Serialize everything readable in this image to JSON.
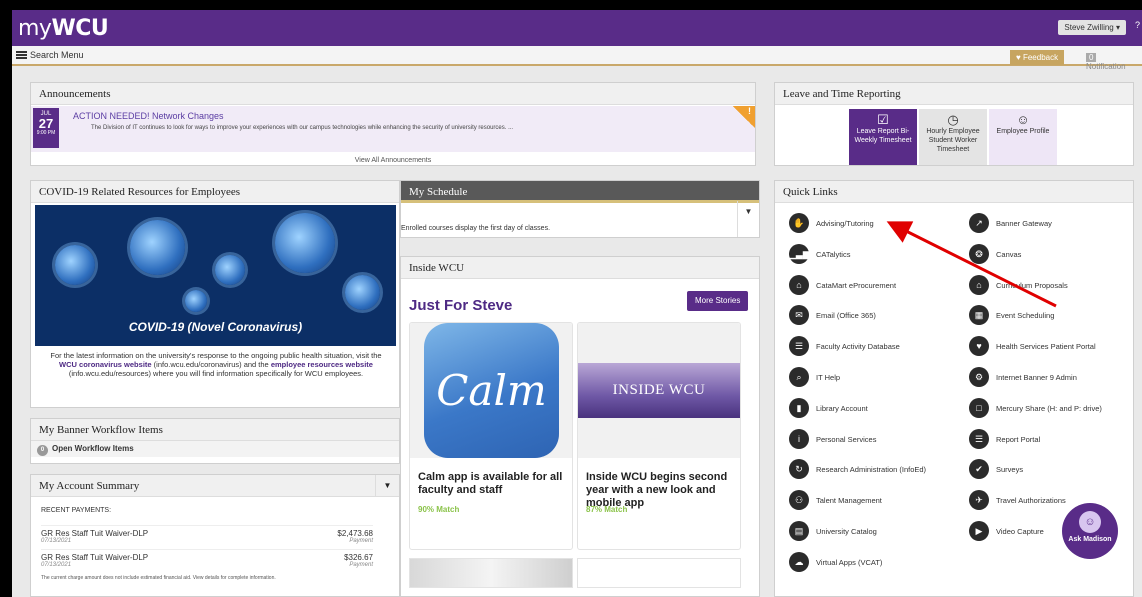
{
  "header": {
    "logo_prefix": "my",
    "logo_bold": "WCU",
    "user_menu": "Steve Zwilling ▾",
    "user_extra": "?"
  },
  "menubar": {
    "search_menu": "Search Menu",
    "feedback": "♥ Feedback",
    "notif_count": "0",
    "notifications": "Notification"
  },
  "announcements": {
    "title": "Announcements",
    "item": {
      "month": "JUL",
      "day": "27",
      "time": "9:00 PM",
      "headline": "ACTION NEEDED! Network Changes",
      "text": "The Division of IT continues to look for ways to improve your experiences with our campus technologies while enhancing the security of university resources. ...",
      "flag": "!"
    },
    "view_all": "View All Announcements"
  },
  "leave": {
    "title": "Leave and Time Reporting",
    "tiles": [
      {
        "icon": "☑",
        "label": "Leave Report Bi-Weekly Timesheet",
        "active": true
      },
      {
        "icon": "◷",
        "label": "Hourly Employee Student Worker Timesheet",
        "active": false
      },
      {
        "icon": "☺",
        "label": "Employee Profile",
        "active": false
      }
    ]
  },
  "covid": {
    "title": "COVID-19 Related Resources for Employees",
    "image_caption": "COVID-19 (Novel Coronavirus)",
    "text_1": "For the latest information on the university's response to the ongoing public health situation, visit the ",
    "link_1": "WCU coronavirus website",
    "text_2": " (info.wcu.edu/coronavirus) and the ",
    "link_2": "employee resources website",
    "text_3": " (info.wcu.edu/resources) where you will find information specifically for WCU employees."
  },
  "workflow": {
    "title": "My Banner Workflow Items",
    "count": "0",
    "item": "Open Workflow Items"
  },
  "account": {
    "title": "My Account Summary",
    "recent_label": "RECENT PAYMENTS:",
    "payments": [
      {
        "name": "GR Res Staff Tuit Waiver-DLP",
        "date": "07/13/2021",
        "amount": "$2,473.68",
        "type": "Payment"
      },
      {
        "name": "GR Res Staff Tuit Waiver-DLP",
        "date": "07/13/2021",
        "amount": "$326.67",
        "type": "Payment"
      }
    ],
    "note": "The current charge amount does not include estimated financial aid. View details for complete information."
  },
  "schedule": {
    "title": "My Schedule",
    "message": "Enrolled courses display the first day of classes."
  },
  "inside": {
    "title": "Inside WCU",
    "heading": "Just For Steve",
    "more_button": "More Stories",
    "stories": [
      {
        "title": "Calm app is available for all faculty and staff",
        "match": "90% Match",
        "image_text": "Calm"
      },
      {
        "title": "Inside WCU begins second year with a new look and mobile app",
        "match": "87% Match",
        "image_text": "INSIDE WCU"
      }
    ]
  },
  "quick_links": {
    "title": "Quick Links",
    "left": [
      {
        "label": "Advising/Tutoring",
        "icon": "thumbs-up-icon",
        "glyph": "✋"
      },
      {
        "label": "CATalytics",
        "icon": "bar-chart-icon",
        "glyph": "▁▃▆"
      },
      {
        "label": "CataMart eProcurement",
        "icon": "cart-icon",
        "glyph": "⌂"
      },
      {
        "label": "Email (Office 365)",
        "icon": "envelope-icon",
        "glyph": "✉"
      },
      {
        "label": "Faculty Activity Database",
        "icon": "document-icon",
        "glyph": "☰"
      },
      {
        "label": "IT Help",
        "icon": "magnifier-icon",
        "glyph": "⌕"
      },
      {
        "label": "Library Account",
        "icon": "bookmark-icon",
        "glyph": "▮"
      },
      {
        "label": "Personal Services",
        "icon": "info-icon",
        "glyph": "i"
      },
      {
        "label": "Research Administration (InfoEd)",
        "icon": "refresh-icon",
        "glyph": "↻"
      },
      {
        "label": "Talent Management",
        "icon": "people-icon",
        "glyph": "⚇"
      },
      {
        "label": "University Catalog",
        "icon": "book-icon",
        "glyph": "▤"
      },
      {
        "label": "Virtual Apps (VCAT)",
        "icon": "cloud-icon",
        "glyph": "☁"
      }
    ],
    "right": [
      {
        "label": "Banner Gateway",
        "icon": "external-link-icon",
        "glyph": "↗"
      },
      {
        "label": "Canvas",
        "icon": "canvas-icon",
        "glyph": "❂"
      },
      {
        "label": "Curriculum Proposals",
        "icon": "institution-icon",
        "glyph": "⌂"
      },
      {
        "label": "Event Scheduling",
        "icon": "calendar-icon",
        "glyph": "▦"
      },
      {
        "label": "Health Services Patient Portal",
        "icon": "heart-icon",
        "glyph": "♥"
      },
      {
        "label": "Internet Banner 9 Admin",
        "icon": "gears-icon",
        "glyph": "⚙"
      },
      {
        "label": "Mercury Share (H: and P: drive)",
        "icon": "folder-icon",
        "glyph": "□"
      },
      {
        "label": "Report Portal",
        "icon": "database-icon",
        "glyph": "☰"
      },
      {
        "label": "Surveys",
        "icon": "check-icon",
        "glyph": "✔"
      },
      {
        "label": "Travel Authorizations",
        "icon": "plane-icon",
        "glyph": "✈"
      },
      {
        "label": "Video Capture",
        "icon": "video-camera-icon",
        "glyph": "▶"
      }
    ]
  },
  "chat": {
    "face": "☺",
    "label": "Ask Madison"
  },
  "colors": {
    "brand_purple": "#592c88",
    "gold": "#c9a86a",
    "arrow": "#e00000"
  }
}
